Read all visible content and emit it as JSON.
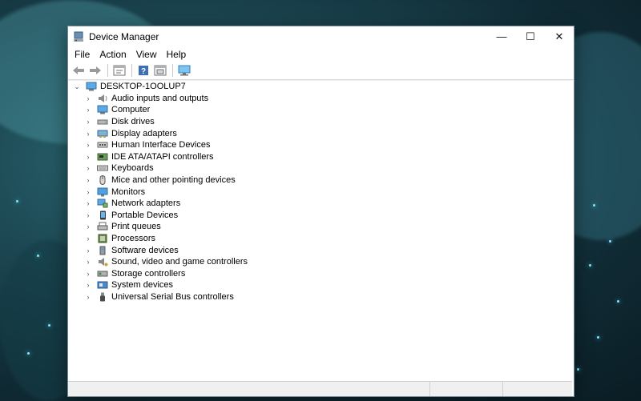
{
  "window": {
    "title": "Device Manager",
    "controls": {
      "minimize": "—",
      "maximize": "☐",
      "close": "✕"
    }
  },
  "menu": [
    "File",
    "Action",
    "View",
    "Help"
  ],
  "toolbar": {
    "buttons": [
      "back-icon",
      "forward-icon",
      "properties-icon",
      "help-icon",
      "update-driver-icon",
      "scan-hardware-icon"
    ]
  },
  "tree": {
    "root": "DESKTOP-1OOLUP7",
    "items": [
      {
        "label": "Audio inputs and outputs",
        "icon": "speaker-icon"
      },
      {
        "label": "Computer",
        "icon": "computer-icon"
      },
      {
        "label": "Disk drives",
        "icon": "disk-drive-icon"
      },
      {
        "label": "Display adapters",
        "icon": "display-adapter-icon"
      },
      {
        "label": "Human Interface Devices",
        "icon": "hid-icon"
      },
      {
        "label": "IDE ATA/ATAPI controllers",
        "icon": "ide-controller-icon"
      },
      {
        "label": "Keyboards",
        "icon": "keyboard-icon"
      },
      {
        "label": "Mice and other pointing devices",
        "icon": "mouse-icon"
      },
      {
        "label": "Monitors",
        "icon": "monitor-icon"
      },
      {
        "label": "Network adapters",
        "icon": "network-adapter-icon"
      },
      {
        "label": "Portable Devices",
        "icon": "portable-device-icon"
      },
      {
        "label": "Print queues",
        "icon": "printer-icon"
      },
      {
        "label": "Processors",
        "icon": "processor-icon"
      },
      {
        "label": "Software devices",
        "icon": "software-device-icon"
      },
      {
        "label": "Sound, video and game controllers",
        "icon": "sound-controller-icon"
      },
      {
        "label": "Storage controllers",
        "icon": "storage-controller-icon"
      },
      {
        "label": "System devices",
        "icon": "system-device-icon"
      },
      {
        "label": "Universal Serial Bus controllers",
        "icon": "usb-icon"
      }
    ]
  },
  "colors": {
    "accent": "#1e88e5",
    "window_bg": "#ffffff",
    "status_bg": "#f0f0f0"
  }
}
